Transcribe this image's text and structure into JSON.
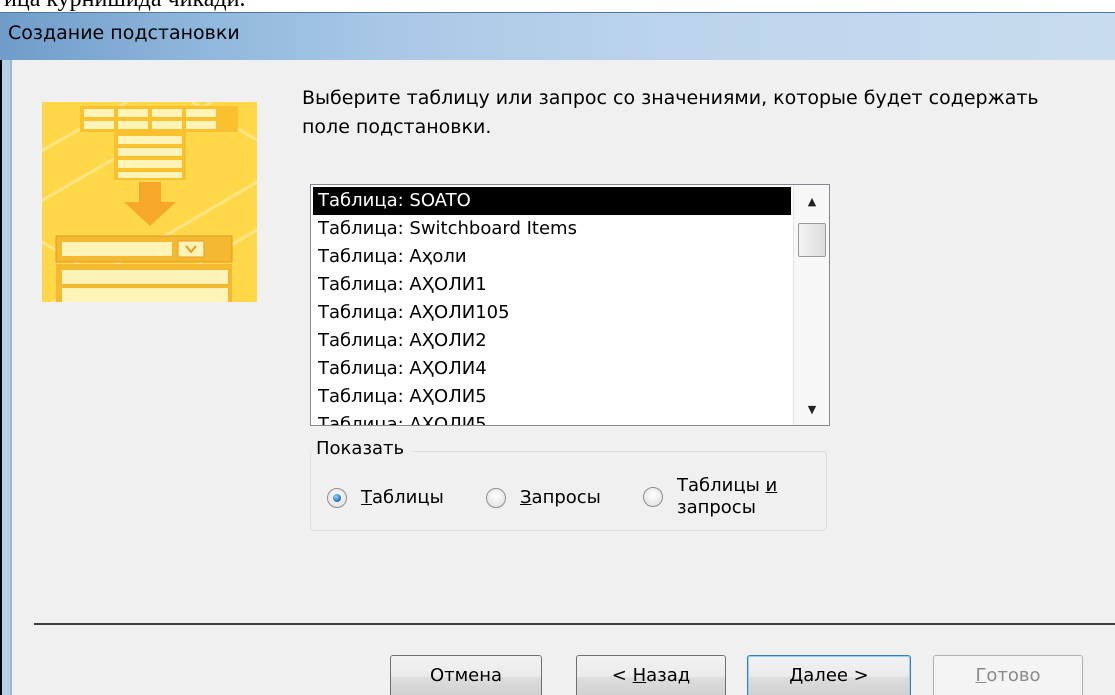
{
  "page_top_text": "ица курнишида чикади.",
  "window": {
    "title": "Создание подстановки"
  },
  "prompt": {
    "line1": "Выберите таблицу или запрос со значениями, которые будет содержать",
    "line2": "поле подстановки."
  },
  "listbox": {
    "selected_index": 0,
    "items": [
      "Таблица: SOATO",
      "Таблица: Switchboard Items",
      "Таблица: Аҳоли",
      "Таблица: АҲОЛИ1",
      "Таблица: АҲОЛИ105",
      "Таблица: АҲОЛИ2",
      "Таблица: АҲОЛИ4",
      "Таблица: АҲОЛИ5",
      "Таблица: АҲОЛИ5"
    ]
  },
  "show_group": {
    "legend": "Показать",
    "selected": "tables",
    "options": {
      "tables": "Таблицы",
      "queries": "Запросы",
      "both_line1": "Таблицы и",
      "both_line2": "запросы"
    }
  },
  "buttons": {
    "cancel": "Отмена",
    "back": "< Назад",
    "next": "Далее >",
    "finish": "Готово"
  },
  "colors": {
    "selection": "#000000",
    "wizard_accent": "#f5a82a",
    "wizard_bg": "#ffd84a"
  },
  "icons": {
    "wizard_image": "lookup-wizard-illustration",
    "scroll_up": "scroll-up-arrow-icon",
    "scroll_down": "scroll-down-arrow-icon"
  }
}
